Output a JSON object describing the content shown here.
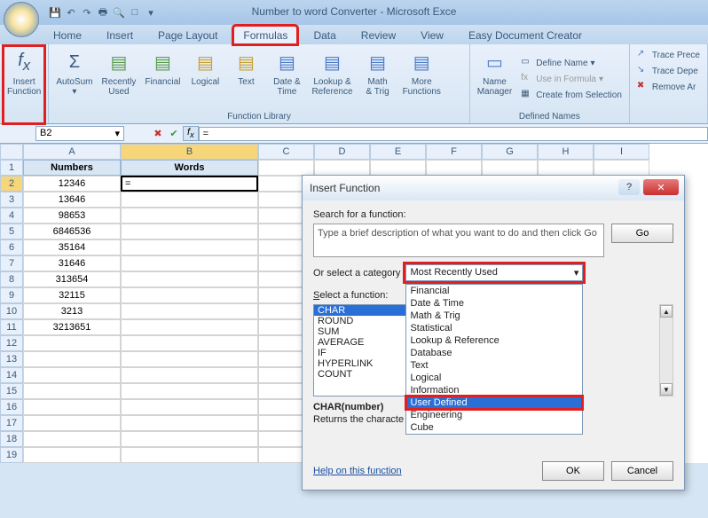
{
  "title": "Number to word Converter - Microsoft Exce",
  "tabs": [
    "Home",
    "Insert",
    "Page Layout",
    "Formulas",
    "Data",
    "Review",
    "View",
    "Easy Document Creator"
  ],
  "active_tab": "Formulas",
  "ribbon": {
    "insert_function": "Insert\nFunction",
    "autosum": "AutoSum",
    "recently_used": "Recently\nUsed",
    "financial": "Financial",
    "logical": "Logical",
    "text": "Text",
    "date_time": "Date &\nTime",
    "lookup": "Lookup &\nReference",
    "math_trig": "Math\n& Trig",
    "more": "More\nFunctions",
    "name_mgr": "Name\nManager",
    "define_name": "Define Name",
    "use_in_formula": "Use in Formula",
    "create_sel": "Create from Selection",
    "trace_prec": "Trace Prece",
    "trace_dep": "Trace Depe",
    "remove_ar": "Remove Ar",
    "group_funclib": "Function Library",
    "group_defnames": "Defined Names"
  },
  "namebox": "B2",
  "formula_value": "=",
  "columns": [
    "A",
    "B",
    "C",
    "D",
    "E",
    "F",
    "G",
    "H",
    "I"
  ],
  "headers": {
    "A": "Numbers",
    "B": "Words"
  },
  "rows": [
    {
      "n": "1",
      "A": "Numbers",
      "B": "Words"
    },
    {
      "n": "2",
      "A": "12346",
      "B": "="
    },
    {
      "n": "3",
      "A": "13646",
      "B": ""
    },
    {
      "n": "4",
      "A": "98653",
      "B": ""
    },
    {
      "n": "5",
      "A": "6846536",
      "B": ""
    },
    {
      "n": "6",
      "A": "35164",
      "B": ""
    },
    {
      "n": "7",
      "A": "31646",
      "B": ""
    },
    {
      "n": "8",
      "A": "313654",
      "B": ""
    },
    {
      "n": "9",
      "A": "32115",
      "B": ""
    },
    {
      "n": "10",
      "A": "3213",
      "B": ""
    },
    {
      "n": "11",
      "A": "3213651",
      "B": ""
    },
    {
      "n": "12",
      "A": "",
      "B": ""
    },
    {
      "n": "13",
      "A": "",
      "B": ""
    },
    {
      "n": "14",
      "A": "",
      "B": ""
    },
    {
      "n": "15",
      "A": "",
      "B": ""
    },
    {
      "n": "16",
      "A": "",
      "B": ""
    },
    {
      "n": "17",
      "A": "",
      "B": ""
    },
    {
      "n": "18",
      "A": "",
      "B": ""
    },
    {
      "n": "19",
      "A": "",
      "B": ""
    }
  ],
  "dialog": {
    "title": "Insert Function",
    "search_label": "Search for a function:",
    "search_placeholder": "Type a brief description of what you want to do and then click Go",
    "go": "Go",
    "cat_label": "Or select a category",
    "cat_value": "Most Recently Used",
    "cat_options": [
      "Financial",
      "Date & Time",
      "Math & Trig",
      "Statistical",
      "Lookup & Reference",
      "Database",
      "Text",
      "Logical",
      "Information",
      "User Defined",
      "Engineering",
      "Cube"
    ],
    "cat_selected": "User Defined",
    "func_label": "Select a function:",
    "functions": [
      "CHAR",
      "ROUND",
      "SUM",
      "AVERAGE",
      "IF",
      "HYPERLINK",
      "COUNT"
    ],
    "func_selected": "CHAR",
    "sig": "CHAR(number)",
    "desc": "Returns the characte                                                                     racter set for your computer.",
    "help": "Help on this function",
    "ok": "OK",
    "cancel": "Cancel"
  }
}
